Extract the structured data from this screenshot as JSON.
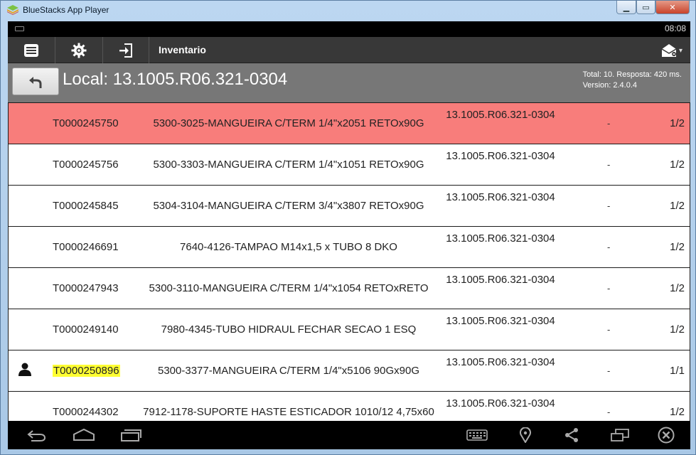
{
  "window": {
    "title": "BlueStacks App Player",
    "controls": {
      "minimize": "▁",
      "maximize": "▭",
      "close": "✕"
    }
  },
  "statusbar": {
    "time": "08:08"
  },
  "actionbar": {
    "title": "Inventario",
    "icons": [
      "list-icon",
      "gear-icon",
      "exit-icon",
      "mail-icon"
    ]
  },
  "location": {
    "title": "Local: 13.1005.R06.321-0304",
    "total_line": "Total: 10. Resposta: 420 ms.",
    "version_line": "Version: 2.4.0.4"
  },
  "items": [
    {
      "code": "T0000245750",
      "desc": "5300-3025-MANGUEIRA C/TERM 1/4\"x2051 RETOx90G",
      "loc": "13.1005.R06.321-0304",
      "dash": "-",
      "qty": "1/2",
      "state": "alert"
    },
    {
      "code": "T0000245756",
      "desc": "5300-3303-MANGUEIRA C/TERM 1/4\"x1051 RETOx90G",
      "loc": "13.1005.R06.321-0304",
      "dash": "-",
      "qty": "1/2",
      "state": "normal"
    },
    {
      "code": "T0000245845",
      "desc": "5304-3104-MANGUEIRA C/TERM 3/4\"x3807 RETOx90G",
      "loc": "13.1005.R06.321-0304",
      "dash": "-",
      "qty": "1/2",
      "state": "normal"
    },
    {
      "code": "T0000246691",
      "desc": "7640-4126-TAMPAO M14x1,5 x TUBO 8 DKO",
      "loc": "13.1005.R06.321-0304",
      "dash": "-",
      "qty": "1/2",
      "state": "normal"
    },
    {
      "code": "T0000247943",
      "desc": "5300-3110-MANGUEIRA C/TERM 1/4\"x1054 RETOxRETO",
      "loc": "13.1005.R06.321-0304",
      "dash": "-",
      "qty": "1/2",
      "state": "normal"
    },
    {
      "code": "T0000249140",
      "desc": "7980-4345-TUBO HIDRAUL FECHAR SECAO 1 ESQ",
      "loc": "13.1005.R06.321-0304",
      "dash": "-",
      "qty": "1/2",
      "state": "normal"
    },
    {
      "code": "T0000250896",
      "desc": "5300-3377-MANGUEIRA C/TERM 1/4\"x5106 90Gx90G",
      "loc": "13.1005.R06.321-0304",
      "dash": "-",
      "qty": "1/1",
      "state": "user"
    },
    {
      "code": "T0000244302",
      "desc": "7912-1178-SUPORTE HASTE ESTICADOR 1010/12 4,75x60",
      "loc": "13.1005.R06.321-0304",
      "dash": "-",
      "qty": "1/2",
      "state": "normal"
    }
  ],
  "colors": {
    "alert_row": "#f87d7b",
    "highlight": "#ffff33",
    "actionbar": "#383838",
    "location_bar": "#777777"
  },
  "navbar": {
    "icons": [
      "back-icon",
      "home-icon",
      "recent-apps-icon",
      "keyboard-icon",
      "location-pin-icon",
      "share-icon",
      "multi-window-icon",
      "close-app-icon"
    ]
  }
}
